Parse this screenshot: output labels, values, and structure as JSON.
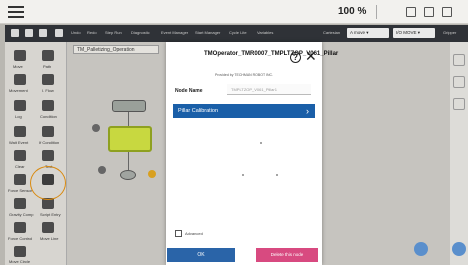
{
  "topbar": {
    "zoom": "100 %"
  },
  "toolbar": {
    "items": [
      "Undo",
      "Redo",
      "Step Run",
      "Diagnostic",
      "Event Manager",
      "Start Manager",
      "Cycle Lite",
      "Variables"
    ],
    "project_label": "Cartesian",
    "dropdown1": "A move ▾",
    "dropdown2": "I/O MOVE ▾",
    "right_label": "Gripper"
  },
  "palette": {
    "labels": [
      "Move",
      "Path",
      "Movement",
      "I. Flow",
      "Log",
      "Condition",
      "Wait Event",
      "If Condition",
      "Clear",
      "Text",
      "Force Sensor",
      "",
      "Gravity Comp",
      "Script Entry",
      "Force Control",
      "Move Line",
      "Move Circle"
    ]
  },
  "canvas": {
    "tab_label": "TM_Palletizing_Operation"
  },
  "dialog": {
    "title": "TMOperator_TMR0007_TMPLTZOP_V061_Pillar",
    "subtitle": "Provided by TECHMAN ROBOT INC.",
    "node_name_label": "Node Name",
    "node_name_value": "TMPLTZOP_V061_Pillar1",
    "calibration_label": "Pillar Calibration",
    "advanced_label": "Advanced",
    "ok_label": "OK",
    "delete_label": "Delete this node"
  },
  "colors": {
    "accent": "#1a5fa8",
    "danger": "#d84a80",
    "toolbar": "#2f3237"
  }
}
